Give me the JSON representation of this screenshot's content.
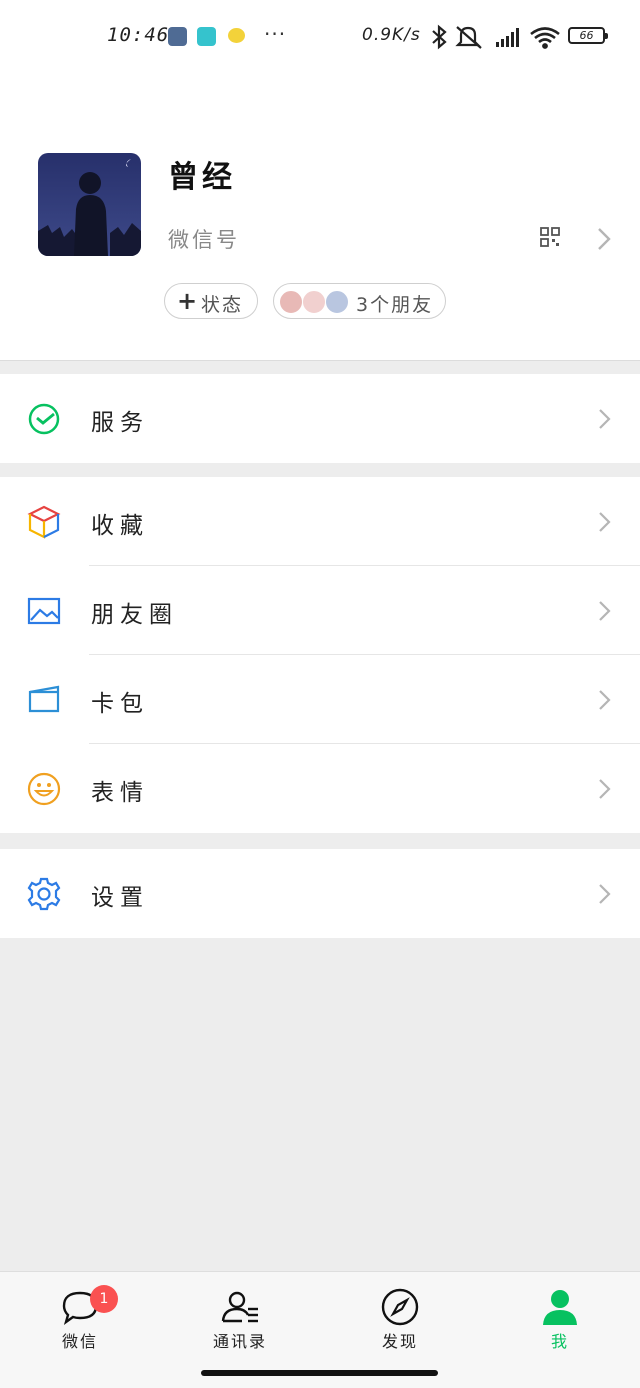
{
  "status_bar": {
    "time": "10:46",
    "more": "···",
    "net_speed": "0.9K/s",
    "battery": "66",
    "icons": [
      "settings-app-icon",
      "app-icon",
      "qq-app-icon",
      "bluetooth-icon",
      "mute-icon",
      "signal-icon",
      "wifi-icon",
      "battery-icon"
    ]
  },
  "profile": {
    "nickname": "曾经",
    "wechat_id": "微信号",
    "status_label": "状态",
    "status_plus": "+",
    "friends_label": "3个朋友"
  },
  "menu": {
    "services": "服务",
    "favorites": "收藏",
    "moments": "朋友圈",
    "cards": "卡包",
    "stickers": "表情",
    "settings": "设置"
  },
  "nav": {
    "chats": "微信",
    "chats_badge": "1",
    "contacts": "通讯录",
    "discover": "发现",
    "me": "我"
  },
  "colors": {
    "accent_green": "#07c160",
    "badge_red": "#fa5151",
    "background": "#ededed"
  }
}
